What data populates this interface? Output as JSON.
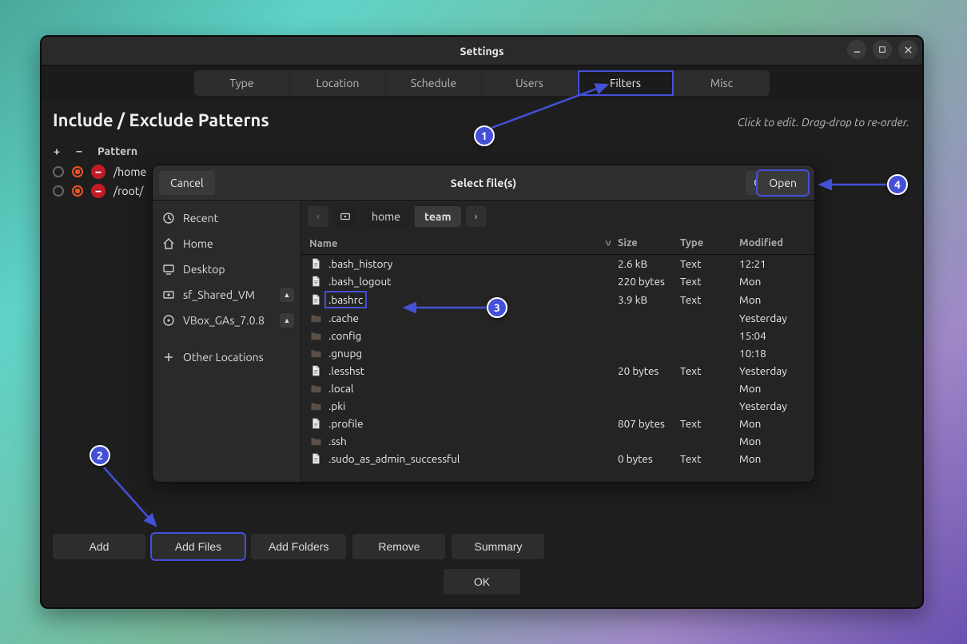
{
  "window": {
    "title": "Settings"
  },
  "tabs": [
    "Type",
    "Location",
    "Schedule",
    "Users",
    "Filters",
    "Misc"
  ],
  "section": {
    "heading": "Include / Exclude Patterns",
    "hint": "Click to edit. Drag-drop to re-order."
  },
  "pattern_columns": {
    "plus": "+",
    "minus": "–",
    "label": "Pattern"
  },
  "patterns": [
    {
      "state": "exclude",
      "path": "/home"
    },
    {
      "state": "exclude",
      "path": "/root/"
    }
  ],
  "buttons": {
    "add": "Add",
    "add_files": "Add Files",
    "add_folders": "Add Folders",
    "remove": "Remove",
    "summary": "Summary",
    "ok": "OK"
  },
  "dialog": {
    "title": "Select file(s)",
    "cancel": "Cancel",
    "open": "Open",
    "places": {
      "recent": "Recent",
      "home": "Home",
      "desktop": "Desktop",
      "shared": "sf_Shared_VM",
      "vbox": "VBox_GAs_7.0.8",
      "other": "Other Locations"
    },
    "breadcrumbs": [
      "home",
      "team"
    ],
    "columns": {
      "name": "Name",
      "size": "Size",
      "type": "Type",
      "modified": "Modified"
    },
    "files": [
      {
        "kind": "file",
        "name": ".bash_history",
        "size": "2.6 kB",
        "type": "Text",
        "modified": "12:21"
      },
      {
        "kind": "file",
        "name": ".bash_logout",
        "size": "220 bytes",
        "type": "Text",
        "modified": "Mon"
      },
      {
        "kind": "file",
        "name": ".bashrc",
        "size": "3.9 kB",
        "type": "Text",
        "modified": "Mon",
        "selected": true
      },
      {
        "kind": "folder",
        "name": ".cache",
        "size": "",
        "type": "",
        "modified": "Yesterday"
      },
      {
        "kind": "folder",
        "name": ".config",
        "size": "",
        "type": "",
        "modified": "15:04"
      },
      {
        "kind": "folder",
        "name": ".gnupg",
        "size": "",
        "type": "",
        "modified": "10:18"
      },
      {
        "kind": "file",
        "name": ".lesshst",
        "size": "20 bytes",
        "type": "Text",
        "modified": "Yesterday"
      },
      {
        "kind": "folder",
        "name": ".local",
        "size": "",
        "type": "",
        "modified": "Mon"
      },
      {
        "kind": "folder",
        "name": ".pki",
        "size": "",
        "type": "",
        "modified": "Yesterday"
      },
      {
        "kind": "file",
        "name": ".profile",
        "size": "807 bytes",
        "type": "Text",
        "modified": "Mon"
      },
      {
        "kind": "folder",
        "name": ".ssh",
        "size": "",
        "type": "",
        "modified": "Mon"
      },
      {
        "kind": "file",
        "name": ".sudo_as_admin_successful",
        "size": "0 bytes",
        "type": "Text",
        "modified": "Mon"
      }
    ]
  },
  "annotations": [
    "1",
    "2",
    "3",
    "4"
  ]
}
